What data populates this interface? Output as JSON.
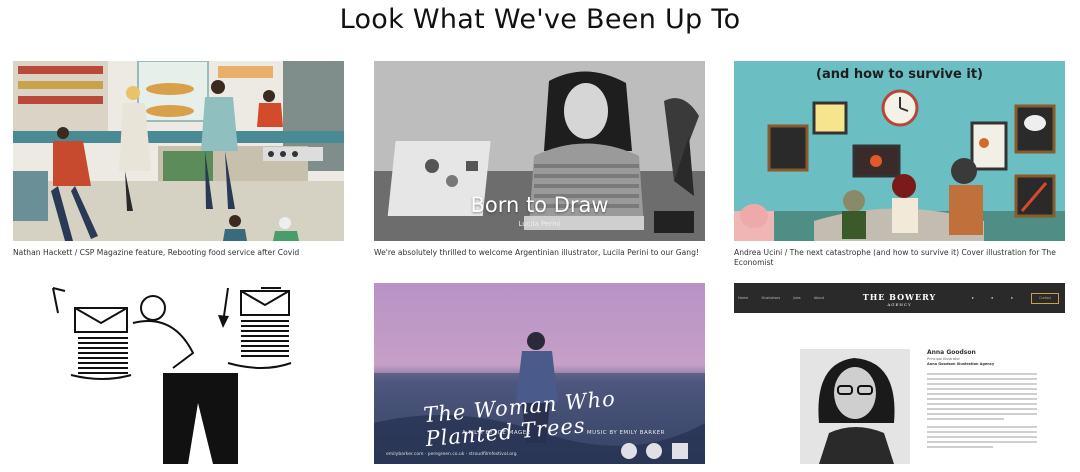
{
  "page": {
    "title": "Look What We've Been Up To"
  },
  "cards": [
    {
      "caption": "Nathan Hackett / CSP Magazine feature, Rebooting food service after Covid"
    },
    {
      "caption": "We're absolutely thrilled to welcome Argentinian illustrator, Lucila Perini to our Gang!",
      "overlay_title": "Born to Draw",
      "overlay_subtitle": "Lucila Perini"
    },
    {
      "caption": "Andrea Ucini / The next catastrophe (and how to survive it) Cover illustration for The Economist",
      "image_heading": "(and how to survive it)"
    },
    {
      "caption": ""
    },
    {
      "caption": "",
      "film_title": "The Woman Who Planted Trees",
      "film_by": "A FILM BY JOE MAGEE",
      "music_by": "MUSIC BY EMILY BARKER",
      "film_footer": "emilybarker.com · peregreen.co.uk · stroudfilmfestival.org"
    },
    {
      "caption": "",
      "bowery_logo": "THE BOWERY",
      "bowery_logo_sub": "AGENCY",
      "bowery_nav": [
        "Home",
        "Illustrators",
        "Jobs",
        "About"
      ],
      "bowery_button": "Contact",
      "bio_name": "Anna Goodson",
      "bio_role": "Principal Illustrator",
      "bio_agency": "Anna Goodson Illustration Agency"
    }
  ],
  "colors": {
    "film_sky": "#b892c6",
    "teal_wall": "#6bbfc2",
    "bowery_bar": "#2a2a2a"
  }
}
